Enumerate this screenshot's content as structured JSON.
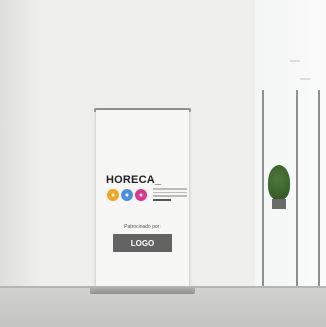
{
  "banner": {
    "brand": "HORECA_",
    "sponsor_text": "Patrocinado por:",
    "logo_text": "LOGO",
    "dot_colors": [
      "#f5a623",
      "#4a90e2",
      "#e0358f"
    ],
    "dot_icons": [
      "●",
      "●",
      "●"
    ],
    "logo_box_color": "#636363"
  },
  "scene": {
    "wall_color": "#efefed",
    "floor_color": "#c9c9c7",
    "plant_icon": "plant-icon"
  }
}
